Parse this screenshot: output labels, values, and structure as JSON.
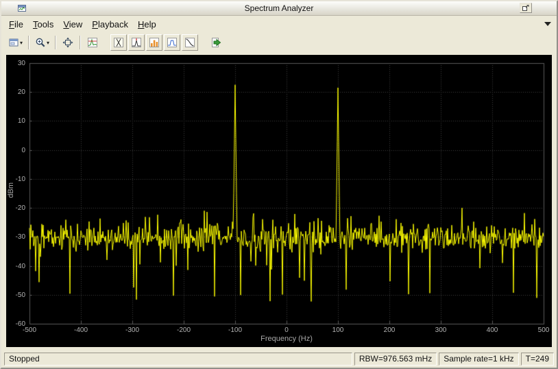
{
  "window": {
    "title": "Spectrum Analyzer"
  },
  "menu_bar": {
    "items": [
      {
        "label": "File",
        "underline": 0
      },
      {
        "label": "Tools",
        "underline": 0
      },
      {
        "label": "View",
        "underline": 0
      },
      {
        "label": "Playback",
        "underline": 0
      },
      {
        "label": "Help",
        "underline": 0
      }
    ]
  },
  "toolbar": {
    "buttons": [
      {
        "name": "configuration-button",
        "icon": "window-icon",
        "has_dropdown": true
      },
      {
        "name": "zoom-button",
        "icon": "magnifier-icon",
        "has_dropdown": true
      },
      {
        "name": "autoscale-button",
        "icon": "expand-arrows-icon",
        "has_dropdown": false
      },
      {
        "name": "spectrum-settings-button",
        "icon": "spectrum-icon",
        "has_dropdown": false
      },
      {
        "name": "cursor-measurements-button",
        "icon": "cursors-icon",
        "has_dropdown": false
      },
      {
        "name": "peak-finder-button",
        "icon": "peak-icon",
        "has_dropdown": false
      },
      {
        "name": "distortion-measurements-button",
        "icon": "orange-bars-icon",
        "has_dropdown": false
      },
      {
        "name": "spectral-mask-button",
        "icon": "mask-icon",
        "has_dropdown": false
      },
      {
        "name": "ccdf-measurements-button",
        "icon": "curve-icon",
        "has_dropdown": false
      },
      {
        "name": "step-forward-button",
        "icon": "green-arrow-icon",
        "has_dropdown": false
      }
    ]
  },
  "status_bar": {
    "state": "Stopped",
    "rbw": "RBW=976.563 mHz",
    "sample_rate": "Sample rate=1 kHz",
    "frame_counter": "T=249"
  },
  "chart_data": {
    "type": "line",
    "title": "",
    "xlabel": "Frequency (Hz)",
    "ylabel": "dBm",
    "xlim": [
      -500,
      500
    ],
    "ylim": [
      -60,
      30
    ],
    "x_ticks": [
      -500,
      -400,
      -300,
      -200,
      -100,
      0,
      100,
      200,
      300,
      400,
      500
    ],
    "y_ticks": [
      30,
      20,
      10,
      0,
      -10,
      -20,
      -30,
      -40,
      -50,
      -60
    ],
    "grid": true,
    "background": "#000000",
    "grid_color": "#3d3d3d",
    "axis_box_color": "#5a5a5a",
    "tick_label_color": "#b2b2b2",
    "series": [
      {
        "name": "spectrum",
        "color": "#ffff00",
        "noise_floor_dbm": -30.5,
        "noise_typical_low_dbm": -38,
        "noise_typical_high_dbm": -23,
        "noise_min_dbm": -55,
        "noise_max_dbm": -18,
        "peaks": [
          {
            "frequency_hz": -100,
            "level_dbm": 22.5
          },
          {
            "frequency_hz": 100,
            "level_dbm": 21.5
          }
        ]
      }
    ]
  }
}
